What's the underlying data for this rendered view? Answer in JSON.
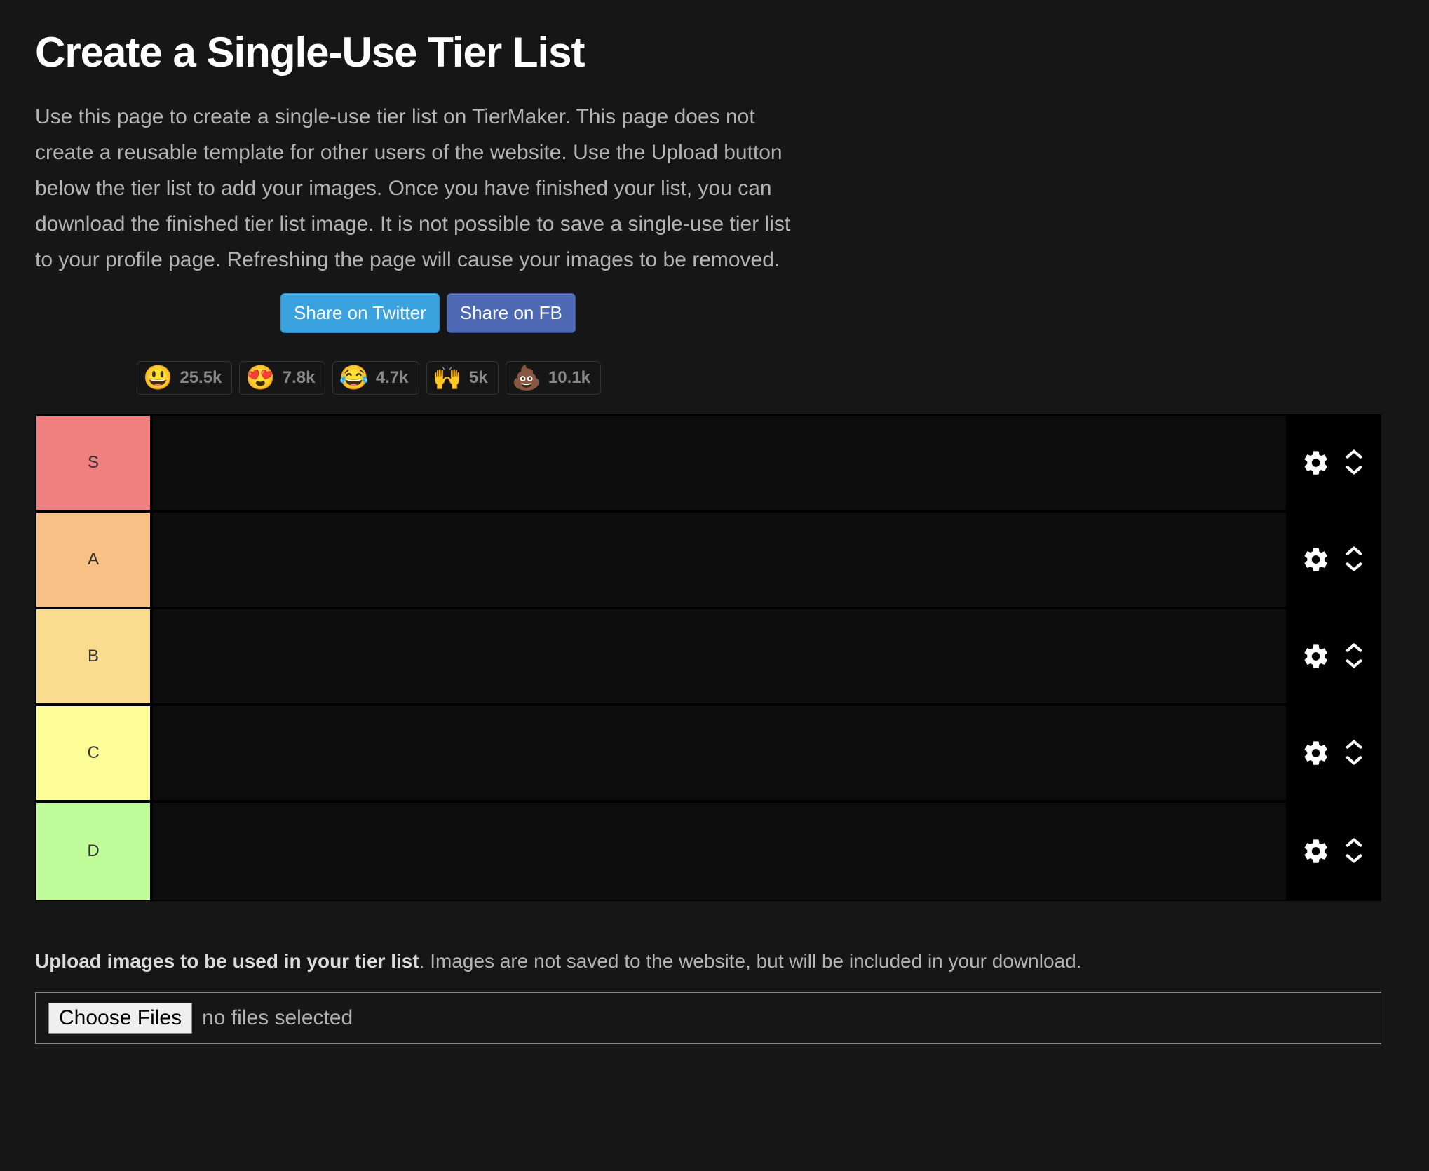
{
  "title": "Create a Single-Use Tier List",
  "description": "Use this page to create a single-use tier list on TierMaker. This page does not create a reusable template for other users of the website. Use the Upload button below the tier list to add your images. Once you have finished your list, you can download the finished tier list image. It is not possible to save a single-use tier list to your profile page. Refreshing the page will cause your images to be removed.",
  "share": {
    "twitter": "Share on Twitter",
    "facebook": "Share on FB"
  },
  "reactions": [
    {
      "emoji": "😃",
      "count": "25.5k"
    },
    {
      "emoji": "😍",
      "count": "7.8k"
    },
    {
      "emoji": "😂",
      "count": "4.7k"
    },
    {
      "emoji": "🙌",
      "count": "5k"
    },
    {
      "emoji": "💩",
      "count": "10.1k"
    }
  ],
  "tiers": [
    {
      "label": "S",
      "color": "#f08080"
    },
    {
      "label": "A",
      "color": "#f9c086"
    },
    {
      "label": "B",
      "color": "#fadc8e"
    },
    {
      "label": "C",
      "color": "#fefe99"
    },
    {
      "label": "D",
      "color": "#c1fc9a"
    }
  ],
  "upload": {
    "bold": "Upload images to be used in your tier list",
    "rest": ". Images are not saved to the website, but will be included in your download.",
    "choose_button": "Choose Files",
    "status": "no files selected"
  }
}
